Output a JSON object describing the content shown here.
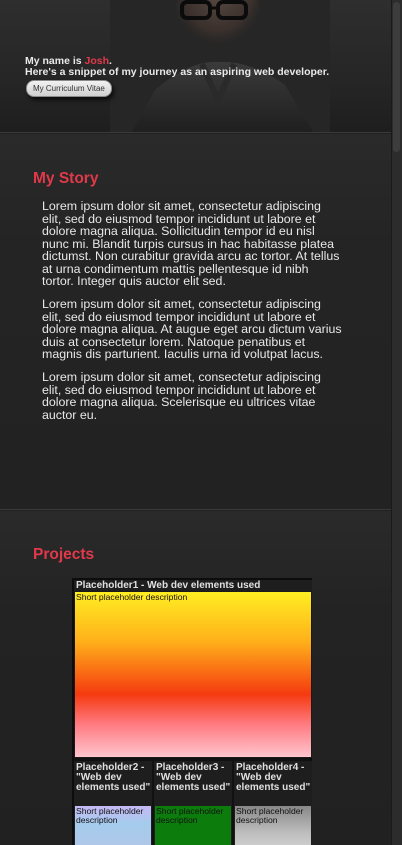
{
  "hero": {
    "intro_prefix": "My name is ",
    "name": "Josh",
    "intro_suffix": ".",
    "tagline": "Here's a snippet of my journey as an aspiring web developer.",
    "cv_button_label": "My Curriculum Vitae"
  },
  "story": {
    "heading": "My Story",
    "paragraphs": [
      "Lorem ipsum dolor sit amet, consectetur adipiscing elit, sed do eiusmod tempor incididunt ut labore et dolore magna aliqua. Sollicitudin tempor id eu nisl nunc mi. Blandit turpis cursus in hac habitasse platea dictumst. Non curabitur gravida arcu ac tortor. At tellus at urna condimentum mattis pellentesque id nibh tortor. Integer quis auctor elit sed.",
      "Lorem ipsum dolor sit amet, consectetur adipiscing elit, sed do eiusmod tempor incididunt ut labore et dolore magna aliqua. At augue eget arcu dictum varius duis at consectetur lorem. Natoque penatibus et magnis dis parturient. Iaculis urna id volutpat lacus.",
      "Lorem ipsum dolor sit amet, consectetur adipiscing elit, sed do eiusmod tempor incididunt ut labore et dolore magna aliqua. Scelerisque eu ultrices vitae auctor eu."
    ]
  },
  "projects": {
    "heading": "Projects",
    "items": [
      {
        "title": "Placeholder1 - Web dev elements used",
        "description": "Short placeholder description"
      },
      {
        "title": "Placeholder2 - \"Web dev elements used\"",
        "description": "Short placeholder description"
      },
      {
        "title": "Placeholder3 - \"Web dev elements used\"",
        "description": "Short placeholder description"
      },
      {
        "title": "Placeholder4 - \"Web dev elements used\"",
        "description": "Short placeholder description"
      }
    ]
  },
  "colors": {
    "accent": "#e2394a",
    "background": "#212121"
  }
}
